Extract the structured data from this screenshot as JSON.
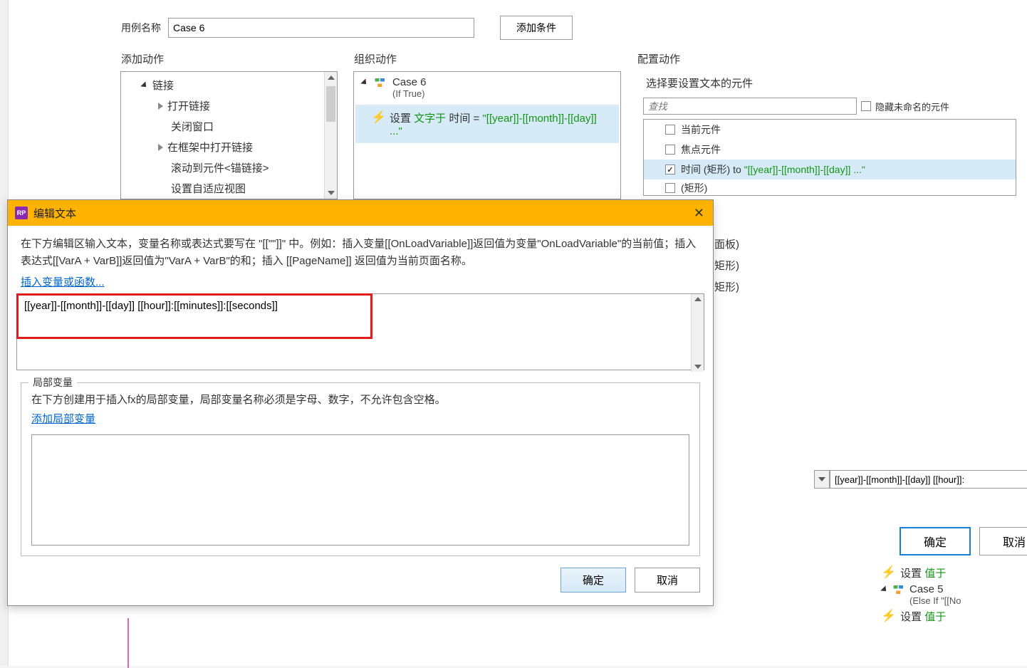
{
  "top": {
    "case_name_label": "用例名称",
    "case_name_value": "Case 6",
    "add_condition_btn": "添加条件"
  },
  "sections": {
    "add_action": "添加动作",
    "org_action": "组织动作",
    "config_action": "配置动作"
  },
  "action_tree": {
    "root": "链接",
    "items": [
      "打开链接",
      "关闭窗口",
      "在框架中打开链接",
      "滚动到元件<锚链接>",
      "设置自适应视图"
    ]
  },
  "org": {
    "case_title": "Case 6",
    "case_cond": "(If True)",
    "action_prefix": "设置 ",
    "action_green1": "文字于",
    "action_mid": " 时间 = ",
    "action_expr": "\"[[year]]-[[month]]-[[day]] ...\""
  },
  "config": {
    "select_widgets": "选择要设置文本的元件",
    "search_ph": "查找",
    "hide_unnamed": "隐藏未命名的元件",
    "items": [
      {
        "label": "当前元件",
        "checked": false
      },
      {
        "label": "焦点元件",
        "checked": false
      },
      {
        "label_pre": "时间 (矩形) to ",
        "label_expr": "\"[[year]]-[[month]]-[[day]] ...\"",
        "checked": true,
        "sel": true
      }
    ],
    "partial_last": "(矩形)"
  },
  "right_items": [
    "面板)",
    "矩形)",
    "矩形)"
  ],
  "modal": {
    "title": "编辑文本",
    "desc": "在下方编辑区输入文本，变量名称或表达式要写在 \"[[\"\"]]\" 中。例如：插入变量[[OnLoadVariable]]返回值为变量\"OnLoadVariable\"的当前值；插入表达式[[VarA + VarB]]返回值为\"VarA + VarB\"的和；插入 [[PageName]] 返回值为当前页面名称。",
    "insert_var_link": "插入变量或函数...",
    "expression": "[[year]]-[[month]]-[[day]] [[hour]]:[[minutes]]:[[seconds]]",
    "locals_legend": "局部变量",
    "locals_desc": "在下方创建用于插入fx的局部变量，局部变量名称必须是字母、数字，不允许包含空格。",
    "add_local_link": "添加局部变量",
    "ok": "确定",
    "cancel": "取消"
  },
  "bottom": {
    "value_input": "[[year]]-[[month]]-[[day]] [[hour]]:",
    "ok": "确定",
    "cancel": "取消"
  },
  "right_cases": {
    "set_label": "设置 ",
    "green": "值于",
    "case5_title": "Case 5",
    "case5_cond": "(Else If \"[[No"
  }
}
